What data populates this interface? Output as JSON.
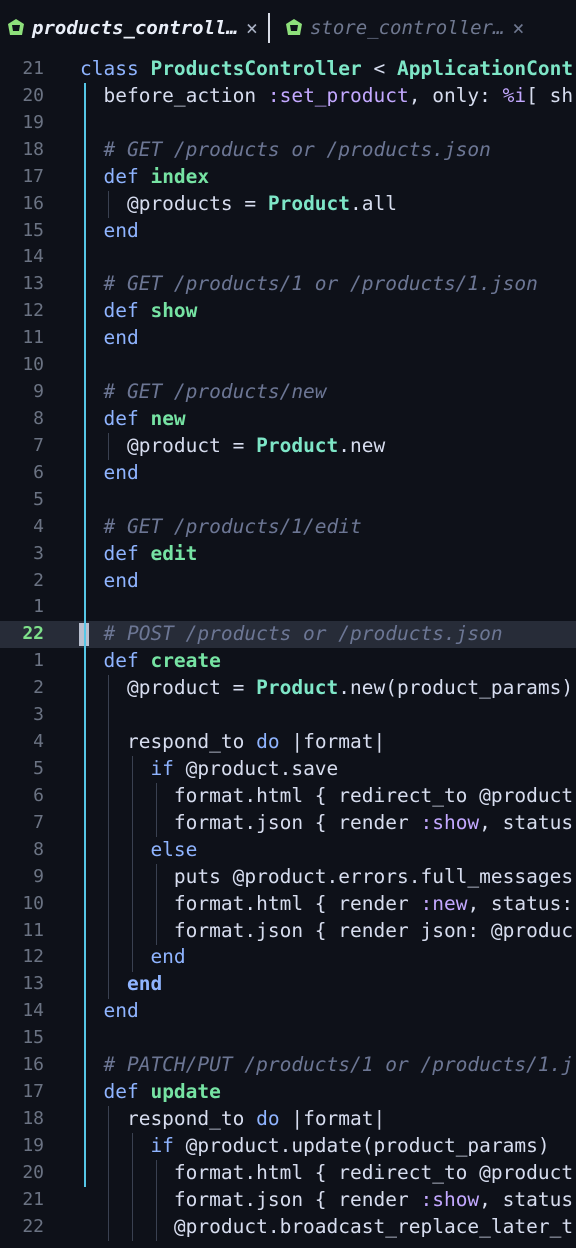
{
  "tabs": [
    {
      "label": "products_controll…",
      "close": "×",
      "active": true
    },
    {
      "label": "store_controller…",
      "close": "×",
      "active": false
    }
  ],
  "lines": [
    {
      "num": "21",
      "tokens": [
        [
          "kw",
          "class "
        ],
        [
          "cls",
          "ProductsController"
        ],
        [
          "tx",
          " < "
        ],
        [
          "cls",
          "ApplicationCont"
        ]
      ]
    },
    {
      "num": "20",
      "tokens": [
        [
          "tx",
          "  before_action "
        ],
        [
          "sym",
          ":set_product"
        ],
        [
          "tx",
          ", only: "
        ],
        [
          "sym",
          "%i"
        ],
        [
          "tx",
          "[ sh"
        ]
      ]
    },
    {
      "num": "19",
      "tokens": []
    },
    {
      "num": "18",
      "tokens": [
        [
          "cm",
          "  # GET /products or /products.json"
        ]
      ]
    },
    {
      "num": "17",
      "tokens": [
        [
          "kw",
          "  def "
        ],
        [
          "def",
          "index"
        ]
      ]
    },
    {
      "num": "16",
      "tokens": [
        [
          "tx",
          "    @products = "
        ],
        [
          "cls",
          "Product"
        ],
        [
          "tx",
          ".all"
        ]
      ]
    },
    {
      "num": "15",
      "tokens": [
        [
          "kw",
          "  end"
        ]
      ]
    },
    {
      "num": "14",
      "tokens": []
    },
    {
      "num": "13",
      "tokens": [
        [
          "cm",
          "  # GET /products/1 or /products/1.json"
        ]
      ]
    },
    {
      "num": "12",
      "tokens": [
        [
          "kw",
          "  def "
        ],
        [
          "def",
          "show"
        ]
      ]
    },
    {
      "num": "11",
      "tokens": [
        [
          "kw",
          "  end"
        ]
      ]
    },
    {
      "num": "10",
      "tokens": []
    },
    {
      "num": "9",
      "tokens": [
        [
          "cm",
          "  # GET /products/new"
        ]
      ]
    },
    {
      "num": "8",
      "tokens": [
        [
          "kw",
          "  def "
        ],
        [
          "def",
          "new"
        ]
      ]
    },
    {
      "num": "7",
      "tokens": [
        [
          "tx",
          "    @product = "
        ],
        [
          "cls",
          "Product"
        ],
        [
          "tx",
          ".new"
        ]
      ]
    },
    {
      "num": "6",
      "tokens": [
        [
          "kw",
          "  end"
        ]
      ]
    },
    {
      "num": "5",
      "tokens": []
    },
    {
      "num": "4",
      "tokens": [
        [
          "cm",
          "  # GET /products/1/edit"
        ]
      ]
    },
    {
      "num": "3",
      "tokens": [
        [
          "kw",
          "  def "
        ],
        [
          "def",
          "edit"
        ]
      ]
    },
    {
      "num": "2",
      "tokens": [
        [
          "kw",
          "  end"
        ]
      ]
    },
    {
      "num": "1",
      "tokens": []
    },
    {
      "num": "22",
      "current": true,
      "tokens": [
        [
          "cm",
          "  # POST /products or /products.json"
        ]
      ]
    },
    {
      "num": "1",
      "tokens": [
        [
          "kw",
          "  def "
        ],
        [
          "def",
          "create"
        ]
      ]
    },
    {
      "num": "2",
      "tokens": [
        [
          "tx",
          "    @product = "
        ],
        [
          "cls",
          "Product"
        ],
        [
          "tx",
          ".new(product_params)"
        ]
      ]
    },
    {
      "num": "3",
      "tokens": []
    },
    {
      "num": "4",
      "tokens": [
        [
          "tx",
          "    respond_to "
        ],
        [
          "kw",
          "do"
        ],
        [
          "tx",
          " |format|"
        ]
      ]
    },
    {
      "num": "5",
      "tokens": [
        [
          "kw",
          "      if "
        ],
        [
          "tx",
          "@product.save"
        ]
      ]
    },
    {
      "num": "6",
      "tokens": [
        [
          "tx",
          "        format.html { redirect_to @product"
        ]
      ]
    },
    {
      "num": "7",
      "tokens": [
        [
          "tx",
          "        format.json { render "
        ],
        [
          "sym",
          ":show"
        ],
        [
          "tx",
          ", status"
        ]
      ]
    },
    {
      "num": "8",
      "tokens": [
        [
          "kw",
          "      else"
        ]
      ]
    },
    {
      "num": "9",
      "tokens": [
        [
          "tx",
          "        puts @product.errors.full_messages"
        ]
      ]
    },
    {
      "num": "10",
      "tokens": [
        [
          "tx",
          "        format.html { render "
        ],
        [
          "sym",
          ":new"
        ],
        [
          "tx",
          ", status:"
        ]
      ]
    },
    {
      "num": "11",
      "tokens": [
        [
          "tx",
          "        format.json { render json: @produc"
        ]
      ]
    },
    {
      "num": "12",
      "tokens": [
        [
          "kw",
          "      end"
        ]
      ]
    },
    {
      "num": "13",
      "tokens": [
        [
          "kw-b",
          "    end"
        ]
      ]
    },
    {
      "num": "14",
      "tokens": [
        [
          "kw",
          "  end"
        ]
      ]
    },
    {
      "num": "15",
      "tokens": []
    },
    {
      "num": "16",
      "tokens": [
        [
          "cm",
          "  # PATCH/PUT /products/1 or /products/1.j"
        ]
      ]
    },
    {
      "num": "17",
      "tokens": [
        [
          "kw",
          "  def "
        ],
        [
          "def",
          "update"
        ]
      ]
    },
    {
      "num": "18",
      "tokens": [
        [
          "tx",
          "    respond_to "
        ],
        [
          "kw",
          "do"
        ],
        [
          "tx",
          " |format|"
        ]
      ]
    },
    {
      "num": "19",
      "tokens": [
        [
          "kw",
          "      if "
        ],
        [
          "tx",
          "@product.update(product_params)"
        ]
      ]
    },
    {
      "num": "20",
      "tokens": [
        [
          "tx",
          "        format.html { redirect_to @product"
        ]
      ]
    },
    {
      "num": "21",
      "tokens": [
        [
          "tx",
          "        format.json { render "
        ],
        [
          "sym",
          ":show"
        ],
        [
          "tx",
          ", status"
        ]
      ]
    },
    {
      "num": "22",
      "tokens": [
        [
          "tx",
          "        @product.broadcast_replace_later_t"
        ]
      ]
    }
  ],
  "colors": {
    "background": "#0e1119",
    "current_line_number": "#7ee08a",
    "keyword": "#8fb4ff",
    "method_name": "#76e3a3",
    "constant": "#7ee6c7",
    "symbol": "#c3a8ff",
    "comment": "#6c7694",
    "ruby_icon": "#8ee07b"
  },
  "icons": {
    "tab_file_icon": "ruby-gem-icon",
    "tab_close": "close-icon"
  }
}
